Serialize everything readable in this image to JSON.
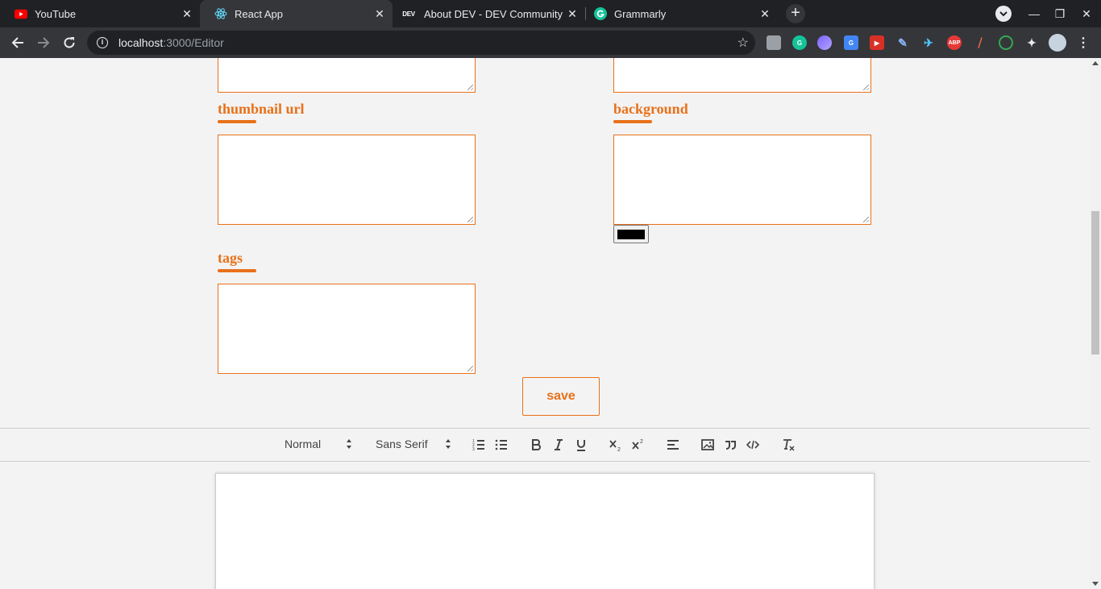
{
  "browser": {
    "tabs": [
      {
        "title": "YouTube",
        "icon": "youtube-icon"
      },
      {
        "title": "React App",
        "icon": "react-icon",
        "active": true
      },
      {
        "title": "About DEV - DEV Community",
        "icon": "dev-icon"
      },
      {
        "title": "Grammarly",
        "icon": "grammarly-icon"
      }
    ],
    "dev_badge": "DEV",
    "url_host": "localhost",
    "url_rest": ":3000/Editor",
    "abp_badge": "ABP"
  },
  "form": {
    "thumbnail_label": "thumbnail url",
    "background_label": "background",
    "tags_label": "tags",
    "background_color": "#000000",
    "save_label": "save",
    "accent_color": "#e8711a"
  },
  "editor": {
    "header_select": "Normal",
    "font_select": "Sans Serif",
    "buttons": [
      "ordered-list",
      "bullet-list",
      "bold",
      "italic",
      "underline",
      "subscript",
      "superscript",
      "align",
      "image",
      "blockquote",
      "code",
      "clean"
    ]
  }
}
